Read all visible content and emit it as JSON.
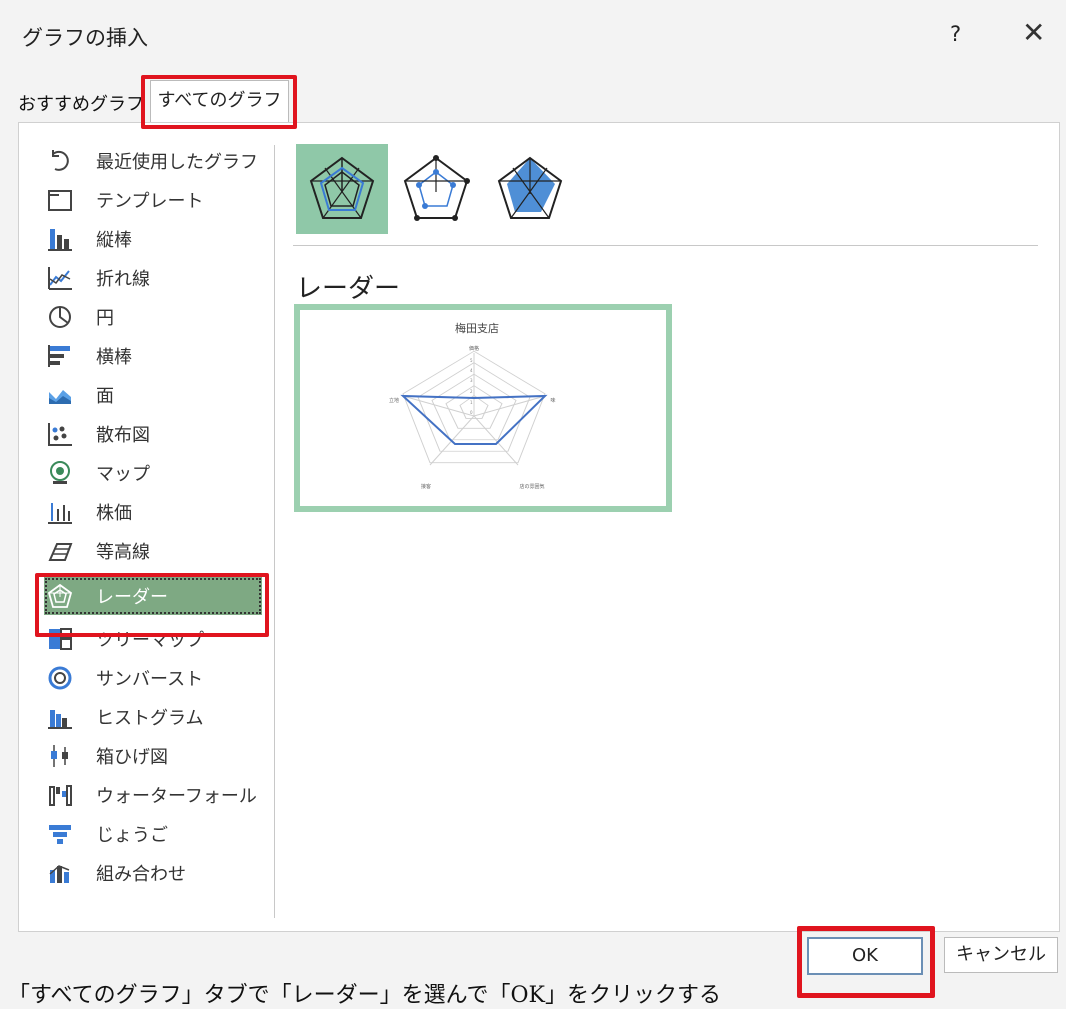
{
  "window": {
    "title": "グラフの挿入",
    "help": "?",
    "close": "✕"
  },
  "tabs": [
    {
      "label": "おすすめグラフ"
    },
    {
      "label": "すべてのグラフ"
    }
  ],
  "sidebar": {
    "items": [
      {
        "label": "最近使用したグラフ",
        "icon": "recent-icon"
      },
      {
        "label": "テンプレート",
        "icon": "template-icon"
      },
      {
        "label": "縦棒",
        "icon": "column-chart-icon"
      },
      {
        "label": "折れ線",
        "icon": "line-chart-icon"
      },
      {
        "label": "円",
        "icon": "pie-chart-icon"
      },
      {
        "label": "横棒",
        "icon": "bar-chart-icon"
      },
      {
        "label": "面",
        "icon": "area-chart-icon"
      },
      {
        "label": "散布図",
        "icon": "scatter-chart-icon"
      },
      {
        "label": "マップ",
        "icon": "map-chart-icon"
      },
      {
        "label": "株価",
        "icon": "stock-chart-icon"
      },
      {
        "label": "等高線",
        "icon": "surface-chart-icon"
      },
      {
        "label": "レーダー",
        "icon": "radar-chart-icon",
        "selected": true
      },
      {
        "label": "ツリーマップ",
        "icon": "treemap-icon"
      },
      {
        "label": "サンバースト",
        "icon": "sunburst-icon"
      },
      {
        "label": "ヒストグラム",
        "icon": "histogram-icon"
      },
      {
        "label": "箱ひげ図",
        "icon": "box-whisker-icon"
      },
      {
        "label": "ウォーターフォール",
        "icon": "waterfall-icon"
      },
      {
        "label": "じょうご",
        "icon": "funnel-icon"
      },
      {
        "label": "組み合わせ",
        "icon": "combo-chart-icon"
      }
    ]
  },
  "main": {
    "chart_type_heading": "レーダー",
    "preview": {
      "title": "梅田支店",
      "axis_labels": [
        "価格",
        "味",
        "店の雰囲気",
        "接客",
        "立地"
      ],
      "tick_labels": [
        "5",
        "4",
        "3",
        "2",
        "1",
        "0"
      ]
    }
  },
  "footer": {
    "ok": "OK",
    "cancel": "キャンセル",
    "caption": "「すべてのグラフ」タブで「レーダー」を選んで「OK」をクリックする"
  },
  "colors": {
    "accent": "#7ea983",
    "highlight": "#e0141e",
    "series": "#4472c4"
  }
}
